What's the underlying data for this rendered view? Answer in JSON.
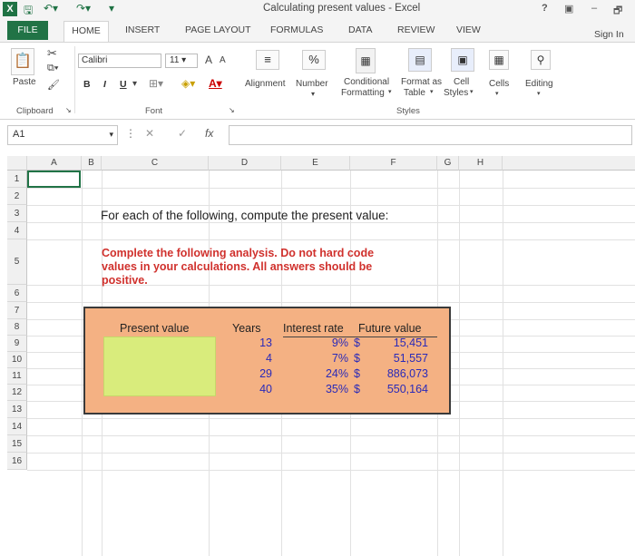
{
  "window": {
    "title": "Calculating present values - Excel",
    "controls": [
      "?",
      "▣",
      "–",
      "🗗"
    ]
  },
  "tabs": {
    "file": "FILE",
    "items": [
      "HOME",
      "INSERT",
      "PAGE LAYOUT",
      "FORMULAS",
      "DATA",
      "REVIEW",
      "VIEW"
    ],
    "sign_in": "Sign In"
  },
  "ribbon": {
    "clipboard": {
      "paste": "Paste",
      "label": "Clipboard"
    },
    "font": {
      "name": "Calibri",
      "size": "11",
      "bold": "B",
      "italic": "I",
      "underline": "U",
      "label": "Font",
      "grow": "A",
      "shrink": "A"
    },
    "alignment": "Alignment",
    "number": {
      "label": "Number",
      "symbol": "%"
    },
    "styles": {
      "conditional_line1": "Conditional",
      "conditional_line2": "Formatting",
      "format_table_line1": "Format as",
      "format_table_line2": "Table",
      "cell_styles_line1": "Cell",
      "cell_styles_line2": "Styles",
      "label": "Styles"
    },
    "cells": "Cells",
    "editing": "Editing"
  },
  "formula_bar": {
    "name_box": "A1",
    "cancel": "✕",
    "enter": "✓",
    "fx": "fx",
    "value": ""
  },
  "columns": [
    "A",
    "B",
    "C",
    "D",
    "E",
    "F",
    "G",
    "H"
  ],
  "rows": [
    "1",
    "2",
    "3",
    "4",
    "5",
    "6",
    "7",
    "8",
    "9",
    "10",
    "11",
    "12",
    "13",
    "14",
    "15",
    "16"
  ],
  "sheet": {
    "prompt": "For each of the following, compute the present value:",
    "instructions": [
      "Complete the following analysis. Do not hard code",
      "values in your calculations. All answers should be",
      "positive."
    ],
    "table": {
      "headers": {
        "present_value": "Present value",
        "years": "Years",
        "interest_rate": "Interest rate",
        "future_value": "Future value"
      },
      "rows": [
        {
          "years": "13",
          "rate": "9%",
          "currency": "$",
          "future_value": "15,451"
        },
        {
          "years": "4",
          "rate": "7%",
          "currency": "$",
          "future_value": "51,557"
        },
        {
          "years": "29",
          "rate": "24%",
          "currency": "$",
          "future_value": "886,073"
        },
        {
          "years": "40",
          "rate": "35%",
          "currency": "$",
          "future_value": "550,164"
        }
      ]
    }
  },
  "colors": {
    "excel_green": "#217346",
    "panel_fill": "#f4b183",
    "input_fill": "#d9ec7c",
    "instruction_red": "#d0312d",
    "value_blue": "#2a2ab8"
  }
}
